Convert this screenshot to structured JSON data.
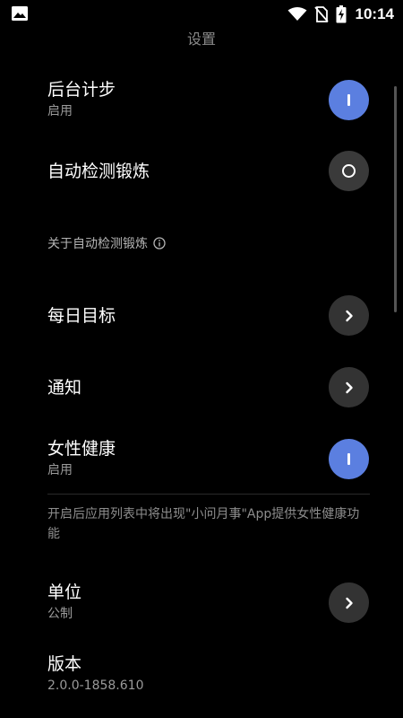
{
  "status_bar": {
    "time": "10:14",
    "icons": [
      "image-icon",
      "wifi-icon",
      "no-sim-icon",
      "battery-charging-icon"
    ]
  },
  "page": {
    "title": "设置"
  },
  "settings": {
    "background_step": {
      "title": "后台计步",
      "subtitle": "启用",
      "state": "on"
    },
    "auto_detect": {
      "title": "自动检测锻炼",
      "state": "off"
    },
    "about_auto_detect": {
      "label": "关于自动检测锻炼",
      "icon": "info-icon"
    },
    "daily_goal": {
      "title": "每日目标",
      "icon": "chevron-right-icon"
    },
    "notification": {
      "title": "通知",
      "icon": "chevron-right-icon"
    },
    "female_health": {
      "title": "女性健康",
      "subtitle": "启用",
      "state": "on"
    },
    "female_health_desc": "开启后应用列表中将出现\"小问月事\"App提供女性健康功能",
    "unit": {
      "title": "单位",
      "subtitle": "公制",
      "icon": "chevron-right-icon"
    },
    "version": {
      "title": "版本",
      "subtitle": "2.0.0-1858.610"
    }
  },
  "colors": {
    "background": "#000000",
    "accent_on": "#5b7fe0",
    "toggle_off": "#3a3a3a",
    "secondary_text": "#9a9a9a"
  }
}
